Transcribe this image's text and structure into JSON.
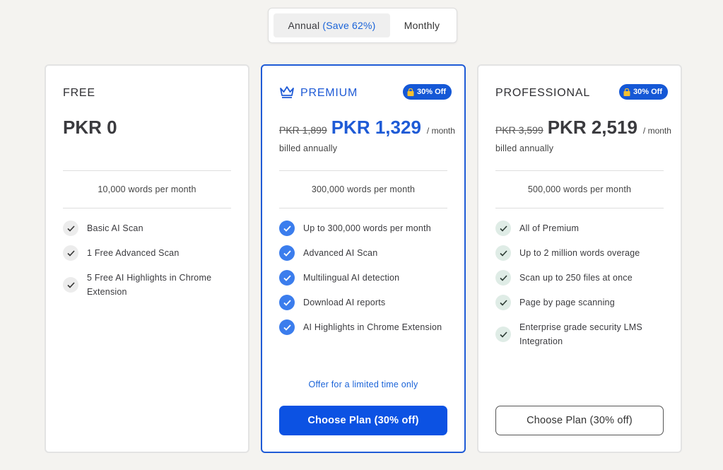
{
  "toggle": {
    "annual_label": "Annual",
    "annual_save": "(Save 62%)",
    "monthly_label": "Monthly"
  },
  "plans": {
    "free": {
      "name": "FREE",
      "price": "PKR 0",
      "words": "10,000 words per month",
      "features": [
        "Basic AI Scan",
        "1 Free Advanced Scan",
        "5 Free AI Highlights in Chrome Extension"
      ]
    },
    "premium": {
      "name": "PREMIUM",
      "badge": "30% Off",
      "old_price": "PKR 1,899",
      "price": "PKR 1,329",
      "per": "/ month",
      "billed": "billed annually",
      "words": "300,000 words per month",
      "features": [
        "Up to 300,000 words per month",
        "Advanced AI Scan",
        "Multilingual AI detection",
        "Download AI reports",
        "AI Highlights in Chrome Extension"
      ],
      "offer": "Offer for a limited time only",
      "button": "Choose Plan (30% off)"
    },
    "pro": {
      "name": "PROFESSIONAL",
      "badge": "30% Off",
      "old_price": "PKR 3,599",
      "price": "PKR 2,519",
      "per": "/ month",
      "billed": "billed annually",
      "words": "500,000 words per month",
      "features": [
        "All of Premium",
        "Up to 2 million words overage",
        "Scan up to 250 files at once",
        "Page by page scanning",
        "Enterprise grade security LMS Integration"
      ],
      "button": "Choose Plan (30% off)"
    }
  },
  "colors": {
    "accent": "#1f5bd6",
    "button": "#0c52e3",
    "background": "#f4f3f0"
  },
  "icons": {
    "crown": "crown-icon",
    "lock": "lock-icon",
    "check": "check-icon"
  }
}
